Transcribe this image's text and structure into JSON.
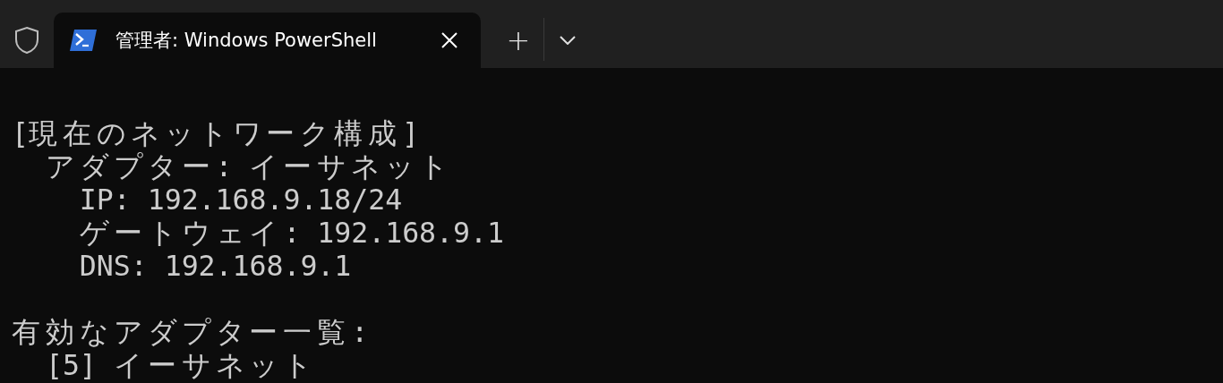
{
  "tab": {
    "title": "管理者: Windows PowerShell",
    "selected": true
  },
  "tab_bar": {
    "new_tab": "+"
  },
  "terminal": {
    "lines": [
      {
        "text": "[現在のネットワーク構成]",
        "children": [
          {
            "text": "アダプター: イーサネット",
            "children": [
              {
                "text": "IP: 192.168.9.18/24"
              },
              {
                "text": "ゲートウェイ: 192.168.9.1"
              },
              {
                "text": "DNS: 192.168.9.1"
              }
            ]
          }
        ]
      },
      {
        "text": "有効なアダプター一覧:",
        "children": [
          {
            "text": "[5] イーサネット"
          }
        ]
      }
    ]
  }
}
